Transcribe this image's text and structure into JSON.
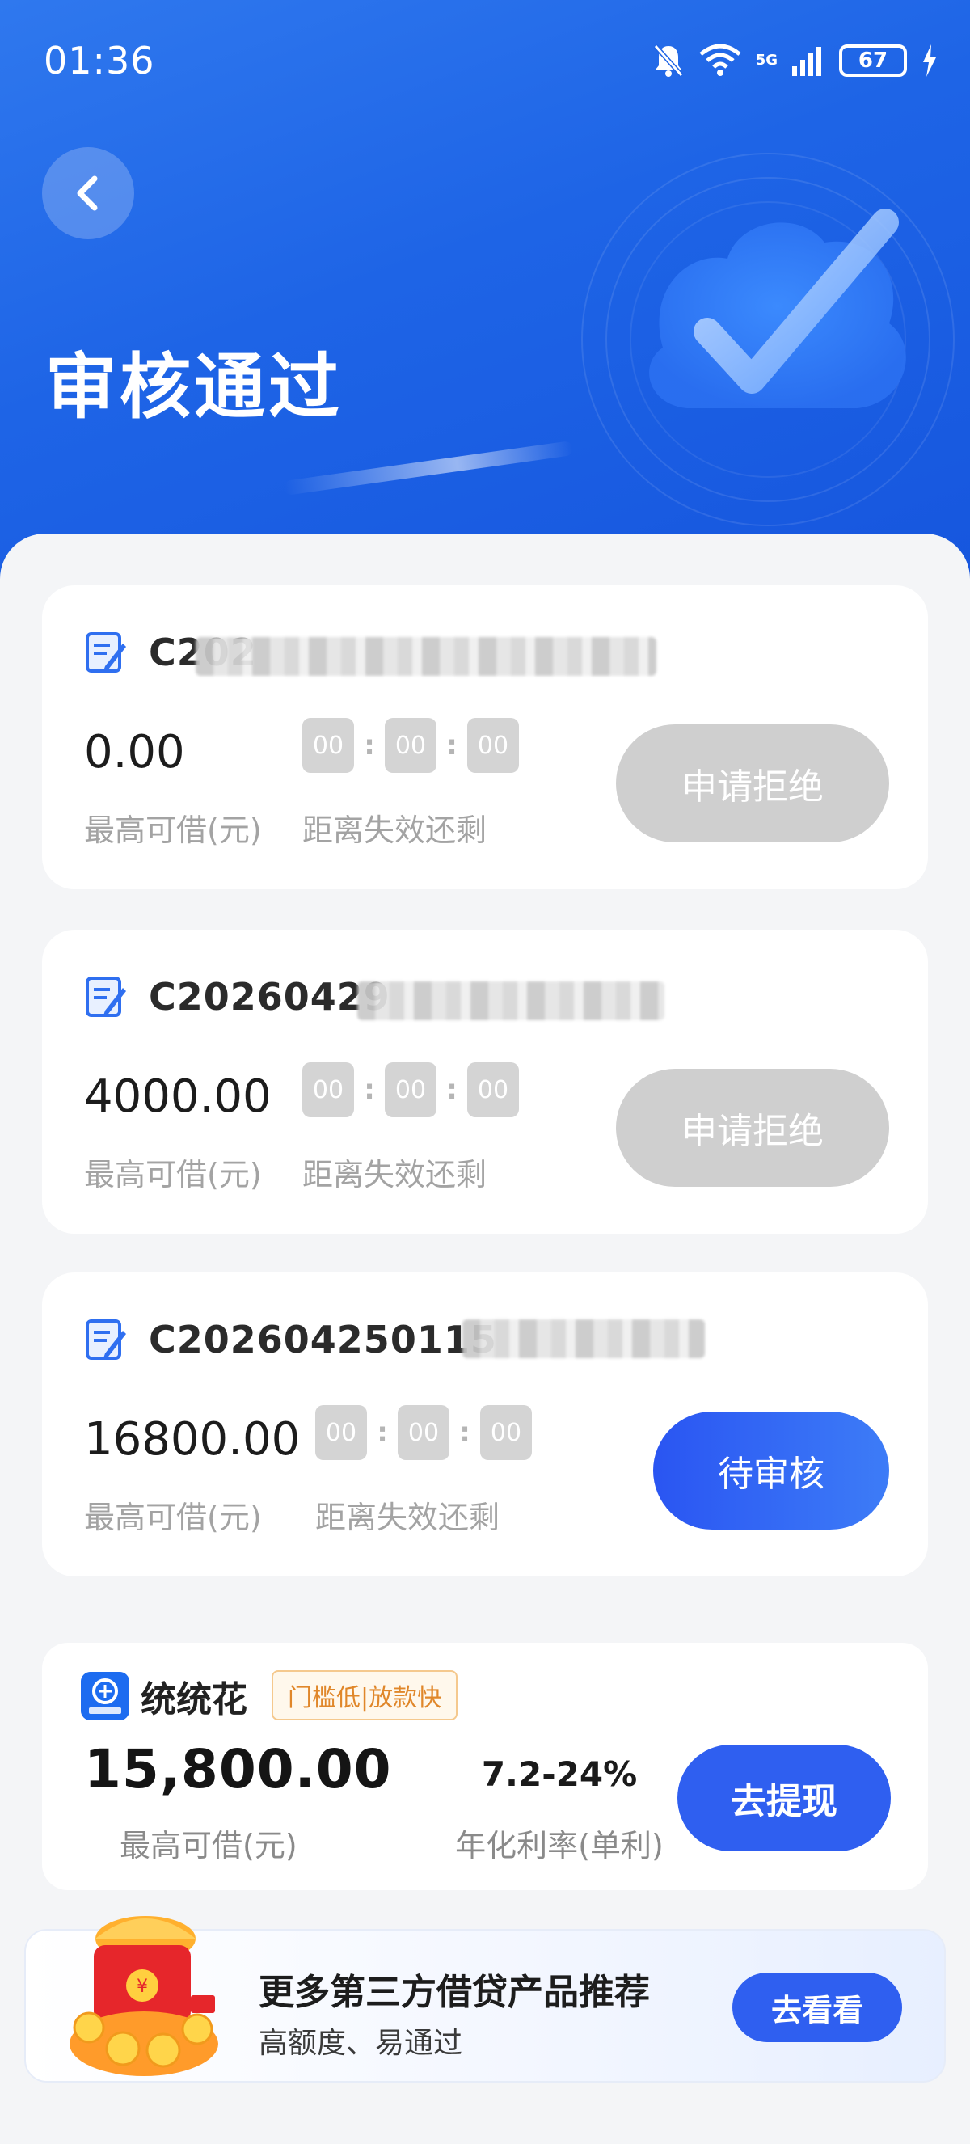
{
  "status_bar": {
    "time": "01:36",
    "network": "5G",
    "battery": "67"
  },
  "header": {
    "title": "审核通过"
  },
  "orders": [
    {
      "id_visible": "C202",
      "amount": "0.00",
      "amount_label": "最高可借(元)",
      "countdown": [
        "00",
        "00",
        "00"
      ],
      "countdown_label": "距离失效还剩",
      "button": "申请拒绝",
      "status": "disabled"
    },
    {
      "id_visible": "C20260429",
      "amount": "4000.00",
      "amount_label": "最高可借(元)",
      "countdown": [
        "00",
        "00",
        "00"
      ],
      "countdown_label": "距离失效还剩",
      "button": "申请拒绝",
      "status": "disabled"
    },
    {
      "id_visible": "C202604250115",
      "amount": "16800.00",
      "amount_label": "最高可借(元)",
      "countdown": [
        "00",
        "00",
        "00"
      ],
      "countdown_label": "距离失效还剩",
      "button": "待审核",
      "status": "pending"
    }
  ],
  "product": {
    "name": "统统花",
    "tag": "门槛低|放款快",
    "amount": "15,800.00",
    "amount_label": "最高可借(元)",
    "rate": "7.2-24%",
    "rate_label": "年化利率(单利)",
    "button": "去提现"
  },
  "promo": {
    "title": "更多第三方借贷产品推荐",
    "subtitle": "高额度、易通过",
    "button": "去看看"
  },
  "colors": {
    "primary": "#2f5ff0",
    "header_blue": "#1e64e6",
    "disabled": "#cfcfcf",
    "tag_orange": "#e0872a"
  }
}
